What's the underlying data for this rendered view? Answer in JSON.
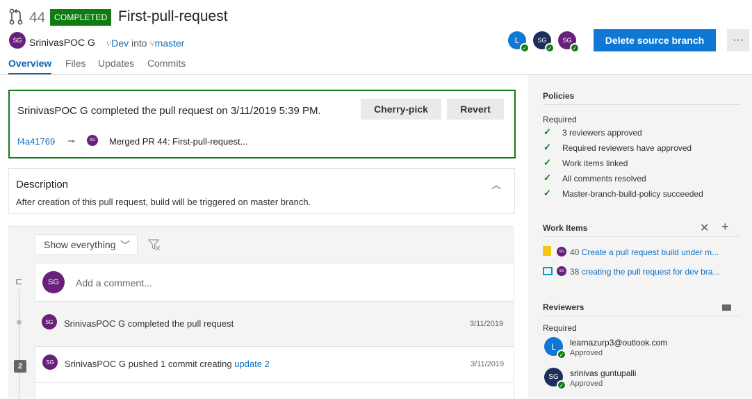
{
  "header": {
    "pr_number": "44",
    "status": "COMPLETED",
    "title": "First-pull-request",
    "author_initials": "SG",
    "author_name": "SrinivasPOC G",
    "source_branch": "Dev",
    "into_text": "into",
    "target_branch": "master",
    "tabs": [
      {
        "label": "Overview"
      },
      {
        "label": "Files"
      },
      {
        "label": "Updates"
      },
      {
        "label": "Commits"
      }
    ],
    "reviewer_avatars": [
      "L",
      "SG",
      "SG"
    ],
    "delete_branch_label": "Delete source branch",
    "more_label": "···"
  },
  "completion": {
    "message": "SrinivasPOC G completed the pull request on 3/11/2019 5:39 PM.",
    "cherry_pick_label": "Cherry-pick",
    "revert_label": "Revert",
    "commit_id": "f4a41769",
    "merge_avatar": "SG",
    "merge_message": "Merged PR 44: First-pull-request..."
  },
  "description": {
    "title": "Description",
    "text": "After creation of this pull request, build will be triggered on master branch."
  },
  "activity": {
    "filter_label": "Show everything",
    "comment_avatar": "SG",
    "comment_placeholder": "Add a comment...",
    "events": [
      {
        "avatar": "SG",
        "text": "SrinivasPOC G completed the pull request",
        "date": "3/11/2019"
      },
      {
        "avatar": "SG",
        "text": "SrinivasPOC G pushed 1 commit creating ",
        "link": "update 2",
        "date": "3/11/2019",
        "update_number": "2"
      }
    ]
  },
  "policies": {
    "title": "Policies",
    "required_label": "Required",
    "items": [
      {
        "label": "3 reviewers approved",
        "link": false
      },
      {
        "label": "Required reviewers have approved",
        "link": false
      },
      {
        "label": "Work items linked",
        "link": false
      },
      {
        "label": "All comments resolved",
        "link": false
      },
      {
        "label": "Master-branch-build-policy succeeded",
        "link": true
      }
    ]
  },
  "work_items": {
    "title": "Work Items",
    "items": [
      {
        "number": "40",
        "title": "Create a pull request build under m...",
        "icon": "clipboard-icon",
        "color": "#f2c811"
      },
      {
        "number": "38",
        "title": "creating the pull request for dev bra...",
        "icon": "book-icon",
        "color": "#009ccc"
      }
    ]
  },
  "reviewers": {
    "title": "Reviewers",
    "required_label": "Required",
    "items": [
      {
        "initials": "L",
        "name": "learnazurp3@outlook.com",
        "status": "Approved",
        "color": "#0e78d4"
      },
      {
        "initials": "SG",
        "name": "srinivas guntupalli",
        "status": "Approved",
        "color": "#1d2f5c"
      }
    ]
  },
  "colors": {
    "accent": "#0e78d4",
    "success": "#107c10",
    "avatar_purple": "#68217a"
  }
}
